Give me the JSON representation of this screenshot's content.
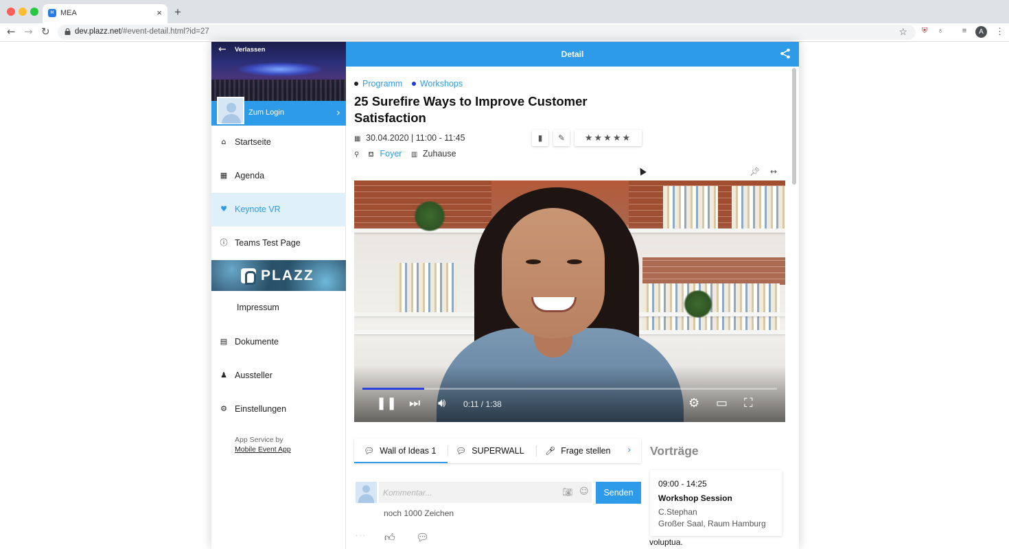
{
  "browser": {
    "tab_title": "MEA",
    "url_host": "dev.plazz.net",
    "url_path": "/#event-detail.html?id=27",
    "profile_initial": "A"
  },
  "sidebar": {
    "leave_label": "Verlassen",
    "login_label": "Zum Login",
    "items": [
      {
        "label": "Startseite",
        "icon": "home-icon"
      },
      {
        "label": "Agenda",
        "icon": "calendar-icon"
      },
      {
        "label": "Keynote VR",
        "icon": "heart-icon",
        "active": true
      },
      {
        "label": "Teams Test Page",
        "icon": "info-icon"
      },
      {
        "label": "Impressum",
        "icon": ""
      },
      {
        "label": "Dokumente",
        "icon": "document-icon"
      },
      {
        "label": "Aussteller",
        "icon": "exhibitor-icon"
      },
      {
        "label": "Einstellungen",
        "icon": "settings-icon"
      }
    ],
    "banner_text": "PLAZZ",
    "service_label": "App Service by",
    "service_link": "Mobile Event App"
  },
  "header": {
    "title": "Detail"
  },
  "event": {
    "categories": [
      {
        "label": "Programm",
        "color": "#222222"
      },
      {
        "label": "Workshops",
        "color": "#1a3be0"
      }
    ],
    "title": "25 Surefire Ways to Improve Customer Satisfaction",
    "datetime": "30.04.2020 | 11:00 - 11:45",
    "location": "Foyer",
    "venue": "Zuhause",
    "rating_stars": "★★★★★"
  },
  "video": {
    "time": "0:11 / 1:38",
    "progress_fraction": 0.149
  },
  "tabs": [
    {
      "label": "Wall of Ideas 1",
      "active": true
    },
    {
      "label": "SUPERWALL",
      "active": false
    },
    {
      "label": "Frage stellen",
      "active": false
    }
  ],
  "comment": {
    "placeholder": "Kommentar...",
    "send_label": "Senden",
    "chars_left": "noch 1000 Zeichen"
  },
  "talks": {
    "heading": "Vorträge",
    "items": [
      {
        "time": "09:00 - 14:25",
        "name": "Workshop Session",
        "speaker": "C.Stephan",
        "room": "Großer Saal, Raum Hamburg"
      }
    ],
    "overflow_text": "voluptua."
  },
  "colors": {
    "accent": "#2d9be8",
    "active_bg": "#dff0fa",
    "progress": "#2d3fe0"
  }
}
